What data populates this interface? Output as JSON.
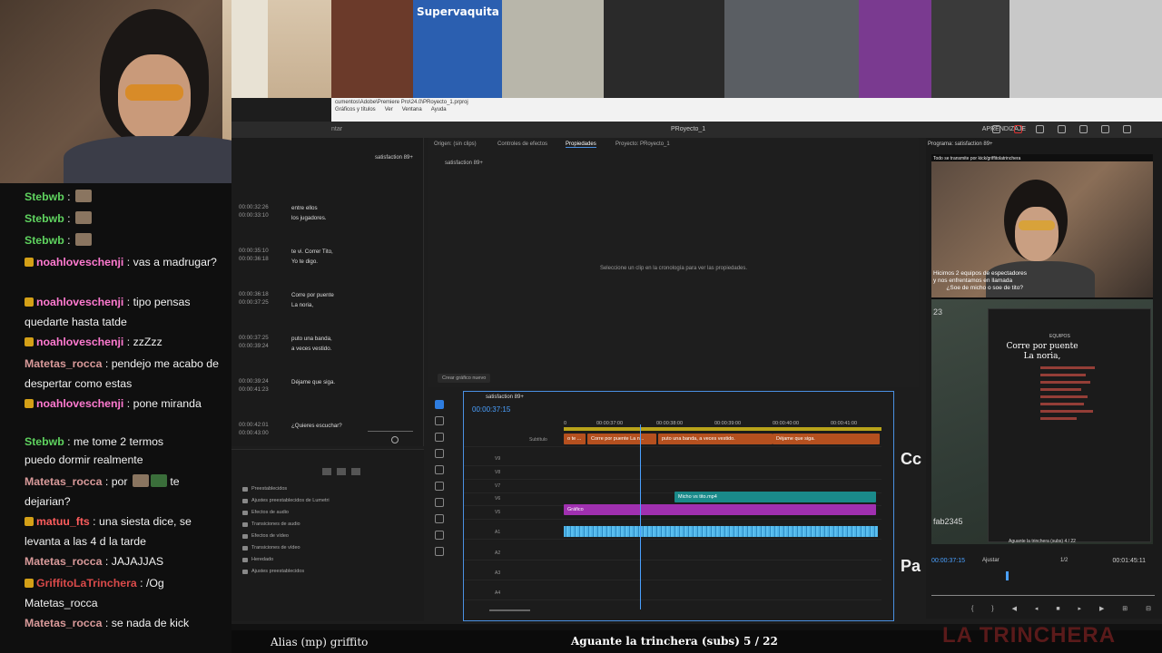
{
  "app": {
    "title": "PRoyecto_1",
    "path": "cumentos\\Adobe\\Premiere Pro\\24.0\\PRoyecto_1.prproj",
    "menu": [
      "Gráficos y títulos",
      "Ver",
      "Ventana",
      "Ayuda"
    ],
    "workspace_label": "APRENDIZAJE",
    "panel_left_label": "ntar"
  },
  "photos": [
    {
      "caption": "",
      "color": "#6b3a2a"
    },
    {
      "caption": "Supervaquita",
      "color": "#2b5fb0"
    },
    {
      "caption": "",
      "color": "#b8b6aa"
    },
    {
      "caption": "",
      "color": "#2a2a2a"
    },
    {
      "caption": "",
      "color": "#5a5e63"
    },
    {
      "caption": "",
      "color": "#7a3a90"
    },
    {
      "caption": "",
      "color": "#3a3a3a"
    },
    {
      "caption": "",
      "color": "#c8c8c8"
    }
  ],
  "text_panel": {
    "tab": "satisfaction 89+",
    "captions": [
      {
        "num": "21",
        "tc_in": "00:00:32:26",
        "tc_out": "00:00:33:10",
        "line1": "entre ellos",
        "line2": "los jugadores."
      },
      {
        "num": "22",
        "tc_in": "00:00:35:10",
        "tc_out": "00:00:36:18",
        "line1": "te vi. Correr Tito,",
        "line2": "Yo te digo."
      },
      {
        "num": "23",
        "tc_in": "00:00:36:18",
        "tc_out": "00:00:37:25",
        "line1": "Corre por puente",
        "line2": "La noria,"
      },
      {
        "num": "24",
        "tc_in": "00:00:37:25",
        "tc_out": "00:00:39:24",
        "line1": "puto una banda,",
        "line2": "a veces vestido."
      },
      {
        "num": "25",
        "tc_in": "00:00:39:24",
        "tc_out": "00:00:41:23",
        "line1": "Déjame que siga.",
        "line2": ""
      },
      {
        "num": "26",
        "tc_in": "00:00:42:01",
        "tc_out": "00:00:43:00",
        "line1": "¿Quieres escuchar?",
        "line2": ""
      }
    ]
  },
  "effects": {
    "items": [
      "Preestablecidos",
      "Ajustes preestablecidos de Lumetri",
      "Efectos de audio",
      "Transiciones de audio",
      "Efectos de vídeo",
      "Transiciones de vídeo",
      "Heredado",
      "Ajustes preestablecidos"
    ]
  },
  "props": {
    "tabs": [
      "Origen: (sin clips)",
      "Controles de efectos",
      "Propiedades",
      "Proyecto: PRoyecto_1"
    ],
    "active_tab": "Propiedades",
    "sequence": "satisfaction 89+",
    "message": "Seleccione un clip en la cronología para ver las propiedades.",
    "new_graphic": "Crear gráfico nuevo"
  },
  "timeline": {
    "sequence_tab": "satisfaction 89+",
    "timecode": "00:00:37:15",
    "ruler": [
      "0",
      "00:00:37:00",
      "00:00:38:00",
      "00:00:39:00",
      "00:00:40:00",
      "00:00:41:00"
    ],
    "tracks": [
      "Subtítulo",
      "V9",
      "V8",
      "V7",
      "V6",
      "V5",
      "A1",
      "A2",
      "A3",
      "A4"
    ],
    "subtitle_clips": [
      "o te ...",
      "Corre por puente La n...",
      "puto una banda, a veces vestido.",
      "Déjame que siga."
    ],
    "video_clip": "Micho vs tito.mp4",
    "graphic_clip": "Gráfico"
  },
  "monitor": {
    "label": "Programa: satisfaction 89+",
    "top_caption": "Todo se transmite por kick/griffitolatrinchera",
    "cam_sub1": "Hicimos 2 equipos de espectadores",
    "cam_sub2": "y nos enfrentamos en llamada",
    "cam_sub3": "¿Soe de micho o soe de tito?",
    "number": "23",
    "subtitle1": "Corre por puente",
    "subtitle2": "La noria,",
    "teams_label": "EQUIPOS",
    "tag": "fab2345",
    "bottom_caption": "Aguante la trinchera (subs) 4 / 22",
    "timecode_left": "00:00:37:15",
    "fit": "Ajustar",
    "quality": "1/2",
    "timecode_right": "00:01:45:11"
  },
  "chat": [
    {
      "user": "Stebwb",
      "color": "#5fd35f",
      "text": "",
      "badge": false,
      "emote": "face"
    },
    {
      "user": "Stebwb",
      "color": "#5fd35f",
      "text": "",
      "badge": false,
      "emote": "face"
    },
    {
      "user": "Stebwb",
      "color": "#5fd35f",
      "text": "",
      "badge": false,
      "emote": "face"
    },
    {
      "user": "noahloveschenji",
      "color": "#ff7ad0",
      "text": "vas a madrugar?",
      "badge": true
    },
    {
      "user": "noahloveschenji",
      "color": "#ff7ad0",
      "text": "tipo pensas quedarte hasta tatde",
      "badge": true
    },
    {
      "user": "noahloveschenji",
      "color": "#ff7ad0",
      "text": "zzZzz",
      "badge": true
    },
    {
      "user": "Matetas_rocca",
      "color": "#d99a9a",
      "text": "pendejo me acabo de despertar como estas",
      "badge": false
    },
    {
      "user": "noahloveschenji",
      "color": "#ff7ad0",
      "text": "pone miranda",
      "badge": true
    },
    {
      "user": "Stebwb",
      "color": "#5fd35f",
      "text": "me tome 2 termos",
      "badge": false
    },
    {
      "user": "",
      "color": "#ffffff",
      "text": "puedo dormir realmente",
      "badge": false
    },
    {
      "user": "Matetas_rocca",
      "color": "#d99a9a",
      "text": "por",
      "badge": false,
      "trail": "te dejarian?"
    },
    {
      "user": "matuu_fts",
      "color": "#ff5d5d",
      "text": "una siesta dice, se levanta a las 4 d la tarde",
      "badge": true
    },
    {
      "user": "Matetas_rocca",
      "color": "#d99a9a",
      "text": "JAJAJJAS",
      "badge": false
    },
    {
      "user": "GriffitoLaTrinchera",
      "color": "#d94a4a",
      "text": "/Og Matetas_rocca",
      "badge": true
    },
    {
      "user": "Matetas_rocca",
      "color": "#d99a9a",
      "text": "se nada de kick",
      "badge": false
    }
  ],
  "bottombar": {
    "left": "Alias (mp) griffito",
    "center": "Aguante la trinchera (subs) 5 / 22",
    "right": "LA TRINCHERA"
  },
  "side_glyphs": [
    "Cc",
    "Pa"
  ]
}
